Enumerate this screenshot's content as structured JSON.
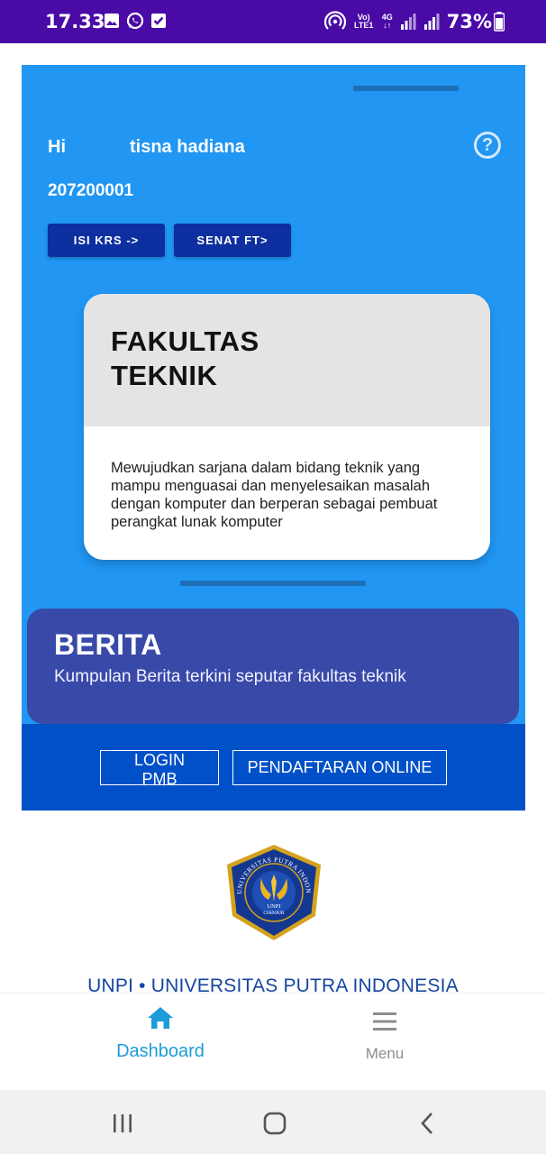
{
  "status_bar": {
    "time": "17.33",
    "battery": "73%",
    "network_volte": "Vo) LTE1",
    "network_gen": "4G",
    "icons": [
      "image-icon",
      "whatsapp-icon",
      "check-box-icon",
      "hotspot-icon",
      "volte-icon",
      "signal-icon",
      "battery-icon"
    ]
  },
  "profile": {
    "greeting": "Hi",
    "name": "tisna hadiana",
    "nim": "207200001",
    "help_label": "?"
  },
  "actions": {
    "krs_label": "ISI KRS ->",
    "senat_label": "SENAT FT>"
  },
  "faculty_card": {
    "title": "FAKULTAS\nTEKNIK",
    "description": "Mewujudkan sarjana dalam bidang teknik yang mampu menguasai dan menyelesaikan masalah dengan komputer dan berperan sebagai pembuat perangkat lunak komputer"
  },
  "news": {
    "title": "BERITA",
    "subtitle": "Kumpulan Berita terkini seputar fakultas teknik"
  },
  "links": {
    "login_label": "LOGIN PMB",
    "register_label": "PENDAFTARAN ONLINE"
  },
  "logo": {
    "ring_text": "UNIVERSITAS PUTRA INDONESIA",
    "inner_text_1": "UNPI",
    "inner_text_2": "CIANJUR"
  },
  "university": {
    "name": "UNPI • UNIVERSITAS PUTRA INDONESIA"
  },
  "bottom_nav": {
    "items": [
      {
        "label": "Dashboard",
        "icon": "home-icon",
        "active": true
      },
      {
        "label": "Menu",
        "icon": "menu-icon",
        "active": false
      }
    ]
  },
  "colors": {
    "status_bar": "#4a0aa6",
    "hero_bg": "#2196f3",
    "dark_button": "#0d2fa0",
    "news_bg": "#3949a8",
    "bar_bg": "#0050c8",
    "active_nav": "#1d9bd8"
  }
}
